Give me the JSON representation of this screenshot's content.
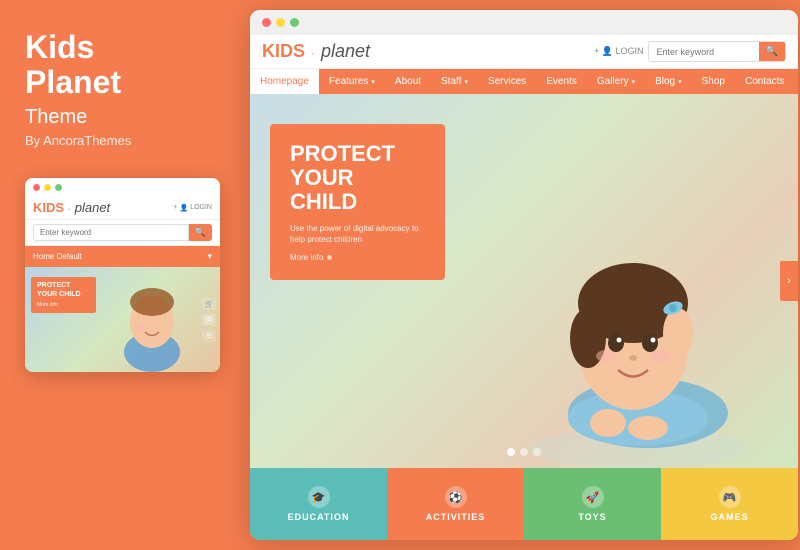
{
  "left": {
    "title": "Kids\nPlanet",
    "subtitle": "Theme",
    "byline": "By AncoraThemes"
  },
  "mobile": {
    "dots": [
      "red",
      "yellow",
      "green"
    ],
    "logo_kids": "KIDS",
    "logo_sep": "·",
    "logo_planet": "planet",
    "login_icon": "👤",
    "login_text": "LOGIN",
    "search_placeholder": "Enter keyword",
    "search_icon": "🔍",
    "nav_label": "Home Default",
    "hero_title": "PROTECT YOUR CHILD",
    "hero_more": "More info",
    "icons": [
      "🛒",
      "🖼",
      "☰"
    ]
  },
  "desktop": {
    "dots": [
      "red",
      "yellow",
      "green"
    ],
    "logo_kids": "KIDS",
    "logo_sep": "·",
    "logo_planet": "planet",
    "login_text": "+ 👤 LOGIN",
    "search_placeholder": "Enter keyword",
    "search_icon": "🔍",
    "nav_items": [
      {
        "label": "Homepage",
        "active": true
      },
      {
        "label": "Features",
        "has_arrow": true
      },
      {
        "label": "About"
      },
      {
        "label": "Staff",
        "has_arrow": true
      },
      {
        "label": "Services"
      },
      {
        "label": "Events"
      },
      {
        "label": "Gallery",
        "has_arrow": true
      },
      {
        "label": "Blog",
        "has_arrow": true
      },
      {
        "label": "Shop"
      },
      {
        "label": "Contacts"
      }
    ],
    "hero_title": "PROTECT YOUR\nCHILD",
    "hero_desc": "Use the power of digital advocacy to help protect children",
    "hero_more": "More info",
    "dots_nav": [
      true,
      false,
      false
    ],
    "cards": [
      {
        "label": "EDUCATION",
        "icon": "🎓",
        "bg": "#5bbcb8"
      },
      {
        "label": "ACTIVITIES",
        "icon": "⚽",
        "bg": "#f47c4e"
      },
      {
        "label": "TOYS",
        "icon": "🚀",
        "bg": "#6abf75"
      },
      {
        "label": "GAMES",
        "icon": "🎮",
        "bg": "#f5c842"
      }
    ]
  }
}
